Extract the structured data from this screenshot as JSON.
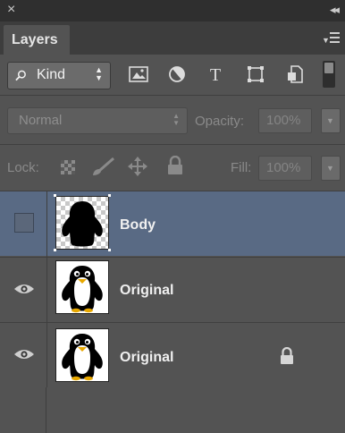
{
  "panel": {
    "close_symbol": "×",
    "collapse_symbol": "◂◂",
    "tab_label": "Layers"
  },
  "filter": {
    "kind_label": "Kind",
    "icons": [
      "image-filter-icon",
      "adjustment-filter-icon",
      "type-filter-icon",
      "shape-filter-icon",
      "smart-object-filter-icon"
    ],
    "type_glyph": "T"
  },
  "blending": {
    "mode": "Normal",
    "opacity_label": "Opacity:",
    "opacity_value": "100%"
  },
  "lock": {
    "label": "Lock:",
    "fill_label": "Fill:",
    "fill_value": "100%"
  },
  "layers": [
    {
      "name": "Body",
      "visible": false,
      "selected": true,
      "locked": false,
      "thumbnail": "penguin-silhouette"
    },
    {
      "name": "Original",
      "visible": true,
      "selected": false,
      "locked": false,
      "thumbnail": "penguin"
    },
    {
      "name": "Original",
      "visible": true,
      "selected": false,
      "locked": true,
      "thumbnail": "penguin"
    }
  ],
  "colors": {
    "panel_bg": "#535353",
    "selected_row": "#596a84",
    "header_bg": "#3d3d3d"
  }
}
